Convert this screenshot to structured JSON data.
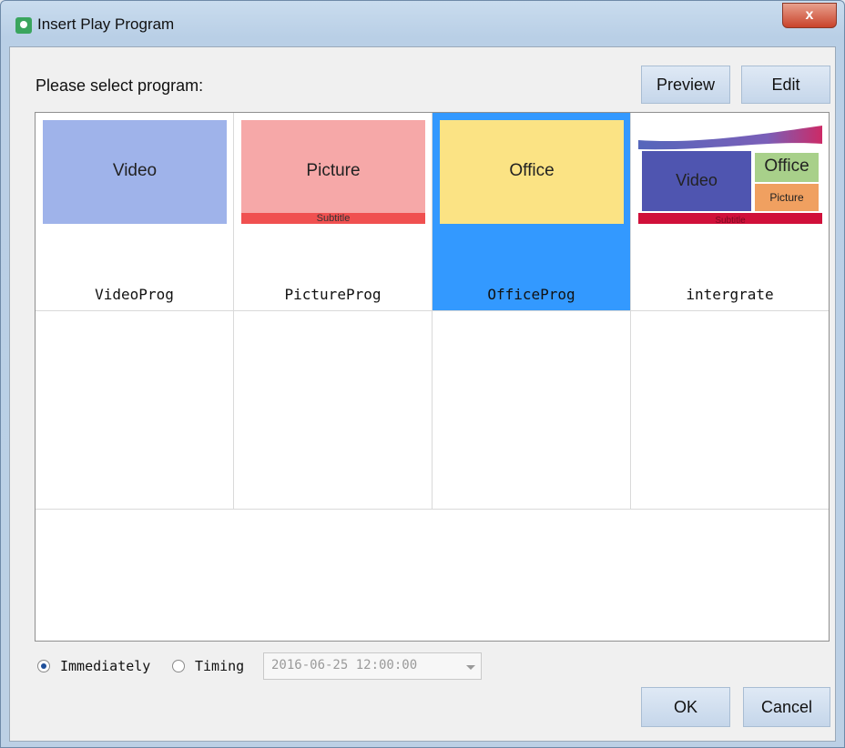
{
  "window": {
    "title": "Insert Play Program",
    "close_glyph": "x"
  },
  "header": {
    "prompt": "Please select program:",
    "preview_label": "Preview",
    "edit_label": "Edit"
  },
  "programs": [
    {
      "name": "VideoProg",
      "thumb_label": "Video",
      "color": "#9fb3ea",
      "selected": false
    },
    {
      "name": "PictureProg",
      "thumb_label": "Picture",
      "thumb_subtitle": "Subtitle",
      "color": "#f6a8a8",
      "subtitle_color": "#f05050",
      "selected": false
    },
    {
      "name": "OfficeProg",
      "thumb_label": "Office",
      "color": "#fbe384",
      "selected": true
    },
    {
      "name": "intergrate",
      "thumb_video": "Video",
      "thumb_office": "Office",
      "thumb_picture": "Picture",
      "thumb_subtitle": "Subtitle",
      "selected": false
    }
  ],
  "schedule": {
    "immediately_label": "Immediately",
    "timing_label": "Timing",
    "immediately_checked": true,
    "datetime_value": "2016-06-25 12:00:00"
  },
  "footer": {
    "ok_label": "OK",
    "cancel_label": "Cancel"
  },
  "colors": {
    "selection": "#3399ff",
    "accent_red": "#d0103a"
  }
}
